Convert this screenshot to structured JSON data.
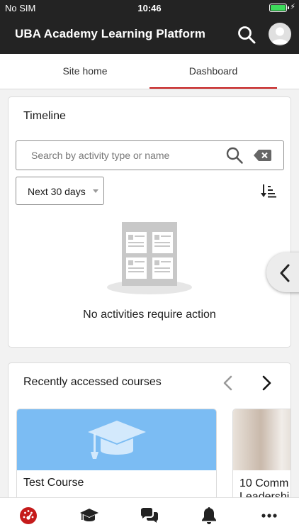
{
  "status": {
    "carrier": "No SIM",
    "time": "10:46",
    "battery_level": 1.0
  },
  "header": {
    "title": "UBA Academy Learning Platform"
  },
  "tabs": [
    {
      "label": "Site home",
      "active": false
    },
    {
      "label": "Dashboard",
      "active": true
    }
  ],
  "timeline": {
    "title": "Timeline",
    "search_placeholder": "Search by activity type or name",
    "filter_value": "Next 30 days",
    "empty_message": "No activities require action"
  },
  "recent": {
    "title": "Recently accessed courses",
    "courses": [
      {
        "name": "Test Course"
      },
      {
        "name": "10 Comm Leadershi"
      }
    ]
  },
  "colors": {
    "topbar": "#232323",
    "accent": "#c51b1b",
    "course_image": "#7bbcf3"
  },
  "bottom_nav": [
    "dashboard-icon",
    "courses-icon",
    "messages-icon",
    "notifications-icon",
    "more-icon"
  ]
}
